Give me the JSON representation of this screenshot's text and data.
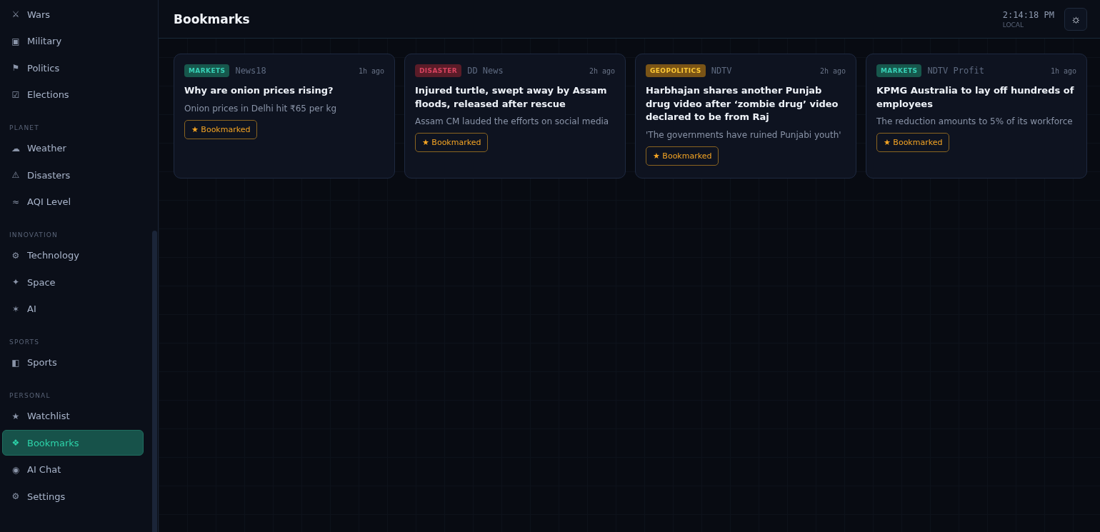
{
  "sidebar": {
    "sections": [
      {
        "items": [
          {
            "icon": "⚔",
            "label": "Wars",
            "selected": false
          },
          {
            "icon": "▣",
            "label": "Military",
            "selected": false
          },
          {
            "icon": "⚑",
            "label": "Politics",
            "selected": false
          },
          {
            "icon": "☑",
            "label": "Elections",
            "selected": false
          }
        ]
      },
      {
        "title": "PLANET",
        "items": [
          {
            "icon": "☁",
            "label": "Weather",
            "selected": false
          },
          {
            "icon": "⚠",
            "label": "Disasters",
            "selected": false
          },
          {
            "icon": "≈",
            "label": "AQI Level",
            "selected": false
          }
        ]
      },
      {
        "title": "INNOVATION",
        "items": [
          {
            "icon": "⚙",
            "label": "Technology",
            "selected": false
          },
          {
            "icon": "✦",
            "label": "Space",
            "selected": false
          },
          {
            "icon": "✶",
            "label": "AI",
            "selected": false
          }
        ]
      },
      {
        "title": "SPORTS",
        "items": [
          {
            "icon": "◧",
            "label": "Sports",
            "selected": false
          }
        ]
      },
      {
        "title": "PERSONAL",
        "items": [
          {
            "icon": "★",
            "label": "Watchlist",
            "selected": false
          },
          {
            "icon": "❖",
            "label": "Bookmarks",
            "selected": true
          },
          {
            "icon": "◉",
            "label": "AI Chat",
            "selected": false
          },
          {
            "icon": "⚙",
            "label": "Settings",
            "selected": false
          }
        ]
      }
    ]
  },
  "header": {
    "title": "Bookmarks",
    "time": "2:14:18 PM",
    "time_label": "LOCAL",
    "theme_button": "☼"
  },
  "cards": [
    {
      "tag": "MARKETS",
      "color": "#17574c",
      "source": "News18",
      "age": "1h ago",
      "title": "Why are onion prices rising?",
      "summary": "Onion prices in Delhi hit ₹65 per kg",
      "bookmark": "★ Bookmarked"
    },
    {
      "tag": "DISASTER",
      "color": "#5a1c28",
      "source": "DD News",
      "age": "2h ago",
      "title": "Injured turtle, swept away by Assam floods, released after rescue",
      "summary": "Assam CM lauded the efforts on social media",
      "bookmark": "★ Bookmarked"
    },
    {
      "tag": "GEOPOLITICS",
      "color": "#7a5416",
      "source": "NDTV",
      "age": "2h ago",
      "title": "Harbhajan shares another Punjab drug video after ‘zombie drug’ video declared to be from Raj",
      "summary": "'The governments have ruined Punjabi youth'",
      "bookmark": "★ Bookmarked"
    },
    {
      "tag": "MARKETS",
      "color": "#17574c",
      "source": "NDTV Profit",
      "age": "1h ago",
      "title": "KPMG Australia to lay off hundreds of employees",
      "summary": "The reduction amounts to 5% of its workforce",
      "bookmark": "★ Bookmarked"
    }
  ]
}
